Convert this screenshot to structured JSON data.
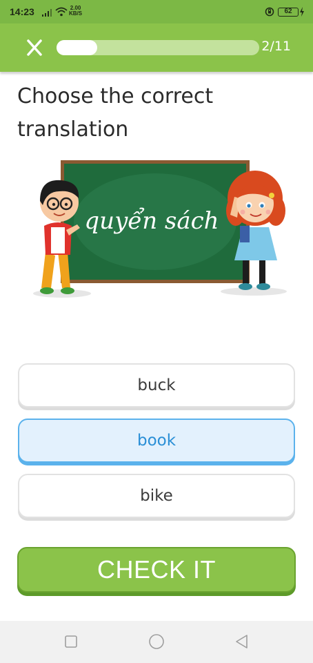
{
  "status_bar": {
    "time": "14:23",
    "net_speed_value": "2.00",
    "net_speed_unit": "KB/S",
    "battery": "62"
  },
  "header": {
    "progress_fraction": 0.2,
    "progress_text": "2/11",
    "accent_color": "#8bc34a"
  },
  "prompt": {
    "line1": "Choose the correct",
    "line2": "translation"
  },
  "illustration": {
    "board_word": "quyển sách"
  },
  "options": [
    {
      "label": "buck",
      "selected": false
    },
    {
      "label": "book",
      "selected": true
    },
    {
      "label": "bike",
      "selected": false
    }
  ],
  "check_button": {
    "label": "CHECK IT"
  },
  "nav": {
    "icons": [
      "square-recents-icon",
      "circle-home-icon",
      "triangle-back-icon"
    ]
  }
}
